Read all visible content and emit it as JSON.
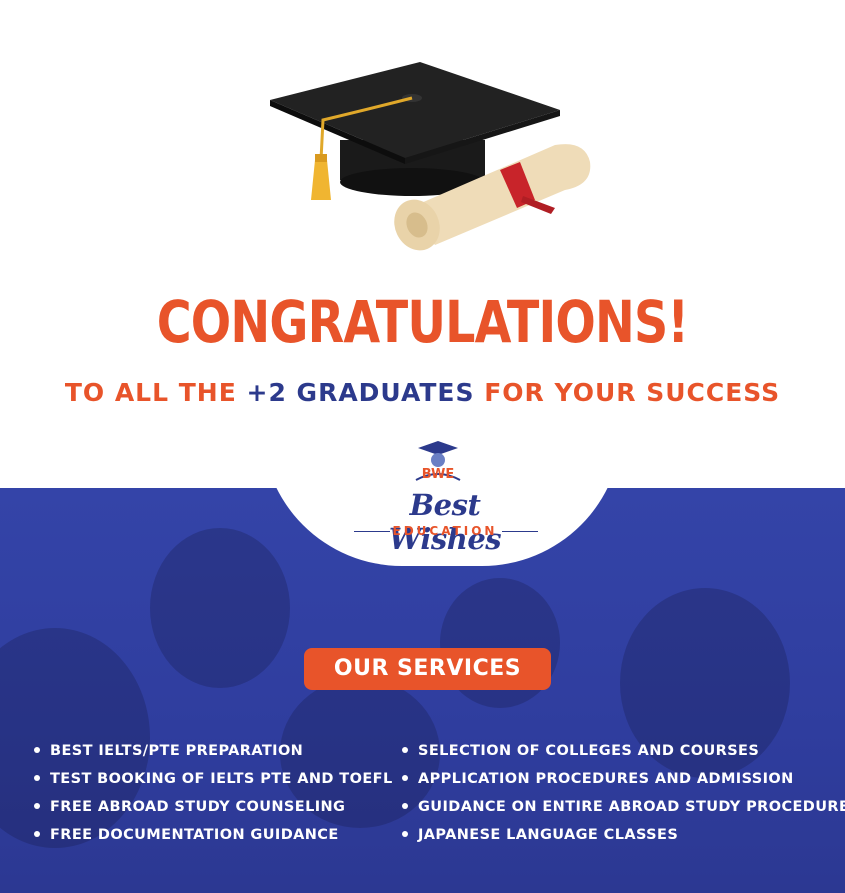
{
  "headline": "CONGRATULATIONS!",
  "subline": {
    "part1": "TO ALL THE ",
    "part2": "+2 GRADUATES",
    "part3": " FOR YOUR SUCCESS"
  },
  "logo": {
    "mark_text": "BWE",
    "name": "Best Wishes",
    "tagline": "EDUCATION"
  },
  "services": {
    "title": "OUR SERVICES",
    "left": [
      "BEST IELTS/PTE PREPARATION",
      "TEST BOOKING OF IELTS PTE AND TOEFL",
      "FREE ABROAD STUDY COUNSELING",
      "FREE DOCUMENTATION GUIDANCE"
    ],
    "right": [
      "SELECTION OF COLLEGES AND COURSES",
      "APPLICATION PROCEDURES AND ADMISSION",
      "GUIDANCE ON ENTIRE ABROAD STUDY PROCEDURE",
      "JAPANESE LANGUAGE CLASSES"
    ]
  },
  "colors": {
    "accent": "#e8542a",
    "brand_navy": "#2c3a8c",
    "panel_blue": "#3444a8"
  },
  "icons": [
    "graduation-cap-icon",
    "diploma-scroll-icon",
    "logo-cap-icon"
  ]
}
